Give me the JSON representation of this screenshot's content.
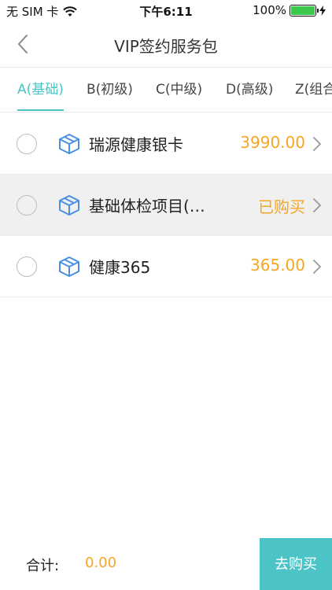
{
  "status_bar": {
    "carrier": "无 SIM 卡",
    "time": "下午6:11",
    "battery_percent": "100%",
    "battery_level": 1.0
  },
  "nav": {
    "title": "VIP签约服务包"
  },
  "tabs": [
    {
      "label": "A(基础)",
      "active": true
    },
    {
      "label": "B(初级)",
      "active": false
    },
    {
      "label": "C(中级)",
      "active": false
    },
    {
      "label": "D(高级)",
      "active": false
    },
    {
      "label": "Z(组合",
      "active": false
    }
  ],
  "items": [
    {
      "name": "瑞源健康银卡",
      "price": "3990.00",
      "purchased": false
    },
    {
      "name": "基础体检项目(…",
      "price": "已购买",
      "purchased": true
    },
    {
      "name": "健康365",
      "price": "365.00",
      "purchased": false
    }
  ],
  "footer": {
    "total_label": "合计:",
    "total_value": "0.00",
    "buy_label": "去购买"
  },
  "colors": {
    "accent": "#4cc3c6",
    "price": "#f5a623",
    "icon": "#4a90e2"
  }
}
